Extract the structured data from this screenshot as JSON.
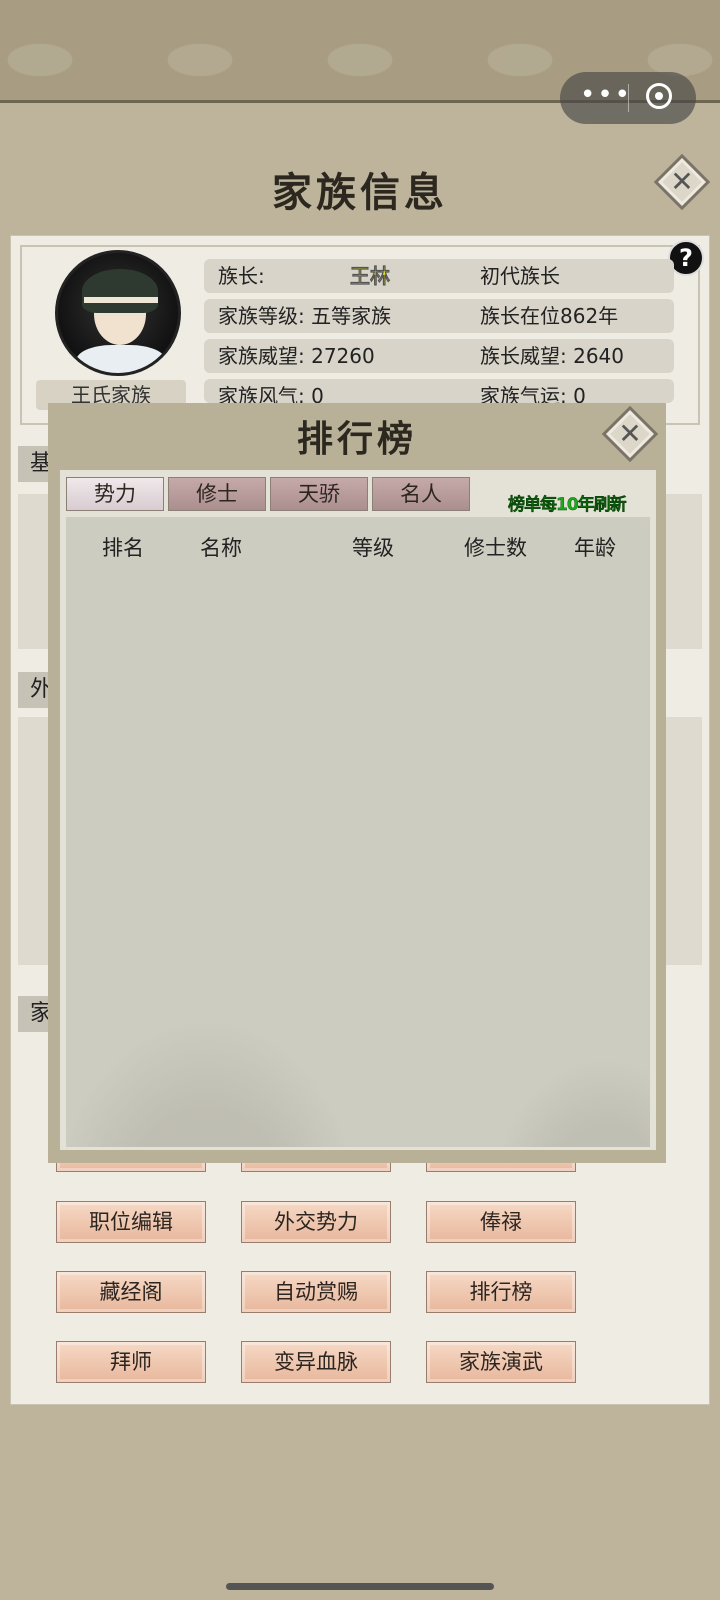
{
  "page": {
    "title": "家族信息",
    "close_icon": "✕",
    "help_icon": "?"
  },
  "capsule": {
    "dots": "•••"
  },
  "profile": {
    "family_name": "王氏家族",
    "rows": [
      {
        "label": "族长:",
        "value": "王林",
        "extra": "初代族长"
      },
      {
        "label": "家族等级: 五等家族",
        "extra": "族长在位862年"
      },
      {
        "label": "家族威望: 27260",
        "extra": "族长威望: 2640"
      },
      {
        "label": "家族风气: 0",
        "extra": "家族气运: 0"
      }
    ]
  },
  "sections": [
    "基",
    "外",
    "家"
  ],
  "buttons": [
    [
      "职位编辑",
      "外交势力",
      "俸禄"
    ],
    [
      "藏经阁",
      "自动赏赐",
      "排行榜"
    ],
    [
      "拜师",
      "变异血脉",
      "家族演武"
    ]
  ],
  "ranking": {
    "title": "排行榜",
    "tabs": [
      "势力",
      "修士",
      "天骄",
      "名人"
    ],
    "active_tab": "势力",
    "refresh_note": "榜单每10年刷新",
    "columns": [
      "排名",
      "名称",
      "等级",
      "修士数",
      "年龄"
    ],
    "rows": []
  },
  "colors": {
    "accent_name": "#e7e81a",
    "refresh_note": "#1ea81e",
    "button": "#e8b79c"
  }
}
